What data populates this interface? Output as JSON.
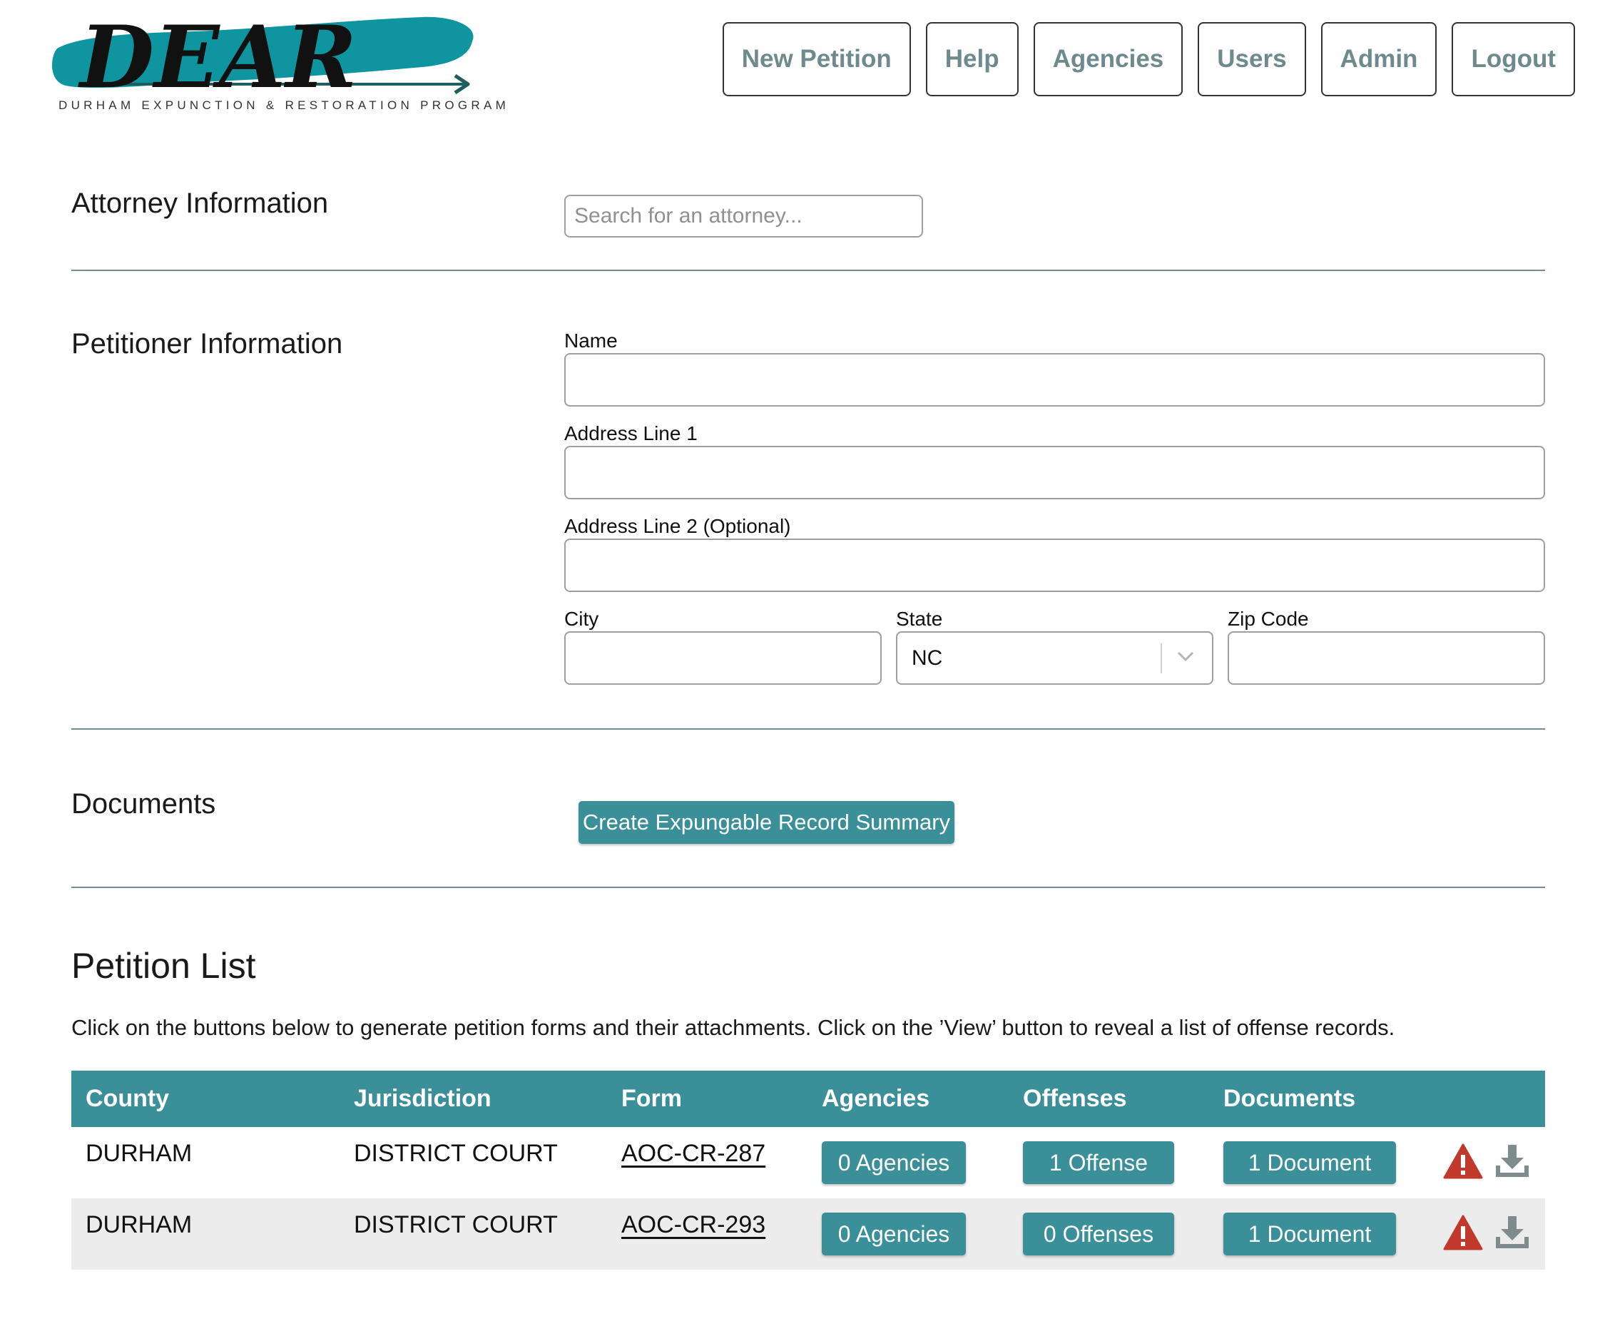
{
  "header": {
    "logo_word": "DEAR",
    "logo_subtitle": "DURHAM EXPUNCTION & RESTORATION PROGRAM",
    "nav": [
      {
        "label": "New Petition"
      },
      {
        "label": "Help"
      },
      {
        "label": "Agencies"
      },
      {
        "label": "Users"
      },
      {
        "label": "Admin"
      },
      {
        "label": "Logout"
      }
    ]
  },
  "attorney": {
    "title": "Attorney Information",
    "search_placeholder": "Search for an attorney..."
  },
  "petitioner": {
    "title": "Petitioner Information",
    "name_label": "Name",
    "address1_label": "Address Line 1",
    "address2_label": "Address Line 2 (Optional)",
    "city_label": "City",
    "state_label": "State",
    "state_value": "NC",
    "zip_label": "Zip Code"
  },
  "documents": {
    "title": "Documents",
    "create_button": "Create Expungable Record Summary"
  },
  "petition_list": {
    "title": "Petition List",
    "description": "Click on the buttons below to generate petition forms and their attachments. Click on the ’View’ button to reveal a list of offense records.",
    "columns": [
      "County",
      "Jurisdiction",
      "Form",
      "Agencies",
      "Offenses",
      "Documents"
    ],
    "rows": [
      {
        "county": "DURHAM",
        "jurisdiction": "DISTRICT COURT",
        "form": "AOC-CR-287",
        "agencies": "0 Agencies",
        "offenses": "1 Offense",
        "documents": "1 Document"
      },
      {
        "county": "DURHAM",
        "jurisdiction": "DISTRICT COURT",
        "form": "AOC-CR-293",
        "agencies": "0 Agencies",
        "offenses": "0 Offenses",
        "documents": "1 Document"
      }
    ]
  },
  "icons": {
    "warning": "warning-triangle-icon",
    "download": "download-icon"
  },
  "colors": {
    "brand_teal": "#3a8f99",
    "logo_teal": "#0f95a0",
    "warning_red": "#c0392b",
    "nav_text": "#6e8a8c"
  }
}
